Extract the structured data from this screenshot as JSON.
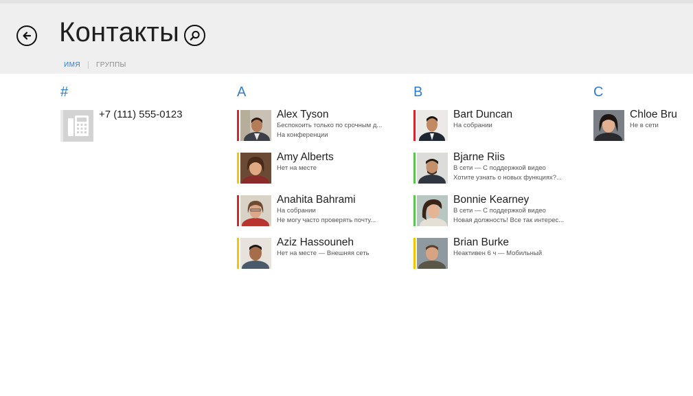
{
  "header": {
    "title": "Контакты",
    "back_icon": "back-arrow-icon",
    "search_icon": "search-icon"
  },
  "tabs": [
    {
      "label": "ИМЯ",
      "active": true
    },
    {
      "label": "ГРУППЫ",
      "active": false
    }
  ],
  "colors": {
    "accent": "#2e7bd1",
    "presence_busy": "#d6262b",
    "presence_away": "#f2c500",
    "presence_available": "#5cc251"
  },
  "groups": [
    {
      "letter": "#",
      "items": [
        {
          "phone": "+7 (111) 555-0123",
          "icon": "phone-icon"
        }
      ]
    },
    {
      "letter": "A",
      "items": [
        {
          "name": "Alex Tyson",
          "status": "Беспокоить только по срочным д...",
          "note": "На конференции",
          "presence": "busy"
        },
        {
          "name": "Amy Alberts",
          "status": "Нет на месте",
          "note": "",
          "presence": "away"
        },
        {
          "name": "Anahita Bahrami",
          "status": "На собрании",
          "note": "Не могу часто проверять почту...",
          "presence": "busy"
        },
        {
          "name": "Aziz Hassouneh",
          "status": "Нет на месте — Внешняя сеть",
          "note": "",
          "presence": "away"
        }
      ]
    },
    {
      "letter": "B",
      "items": [
        {
          "name": "Bart Duncan",
          "status": "На собрании",
          "note": "",
          "presence": "busy"
        },
        {
          "name": "Bjarne Riis",
          "status": "В сети — С поддержкой видео",
          "note": "Хотите узнать о новых функциях?...",
          "presence": "available"
        },
        {
          "name": "Bonnie Kearney",
          "status": "В сети — С поддержкой видео",
          "note": "Новая должность! Все так интерес...",
          "presence": "available"
        },
        {
          "name": "Brian Burke",
          "status": "Неактивен 6 ч — Мобильный",
          "note": "",
          "presence": "away"
        }
      ]
    },
    {
      "letter": "C",
      "items": [
        {
          "name": "Chloe Bru",
          "status": "Не в сети",
          "note": "",
          "presence": "none"
        }
      ]
    }
  ]
}
